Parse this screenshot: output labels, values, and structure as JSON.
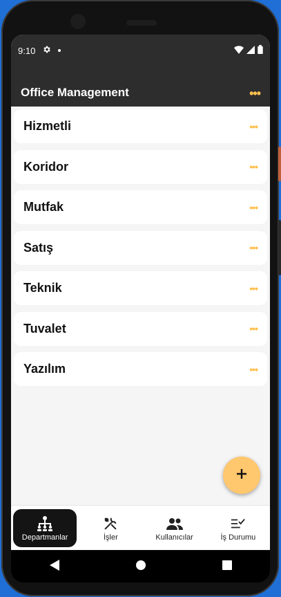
{
  "status": {
    "time": "9:10"
  },
  "appbar": {
    "title": "Office Management"
  },
  "departments": [
    {
      "label": "Hizmetli"
    },
    {
      "label": "Koridor"
    },
    {
      "label": "Mutfak"
    },
    {
      "label": "Satış"
    },
    {
      "label": "Teknik"
    },
    {
      "label": "Tuvalet"
    },
    {
      "label": "Yazılım"
    }
  ],
  "bottom_nav": {
    "departments": "Departmanlar",
    "jobs": "İşler",
    "users": "Kullanıcılar",
    "job_status": "İş Durumu"
  },
  "colors": {
    "accent": "#ffc04d",
    "fab": "#ffc76e",
    "appbar": "#2d2d2d"
  }
}
